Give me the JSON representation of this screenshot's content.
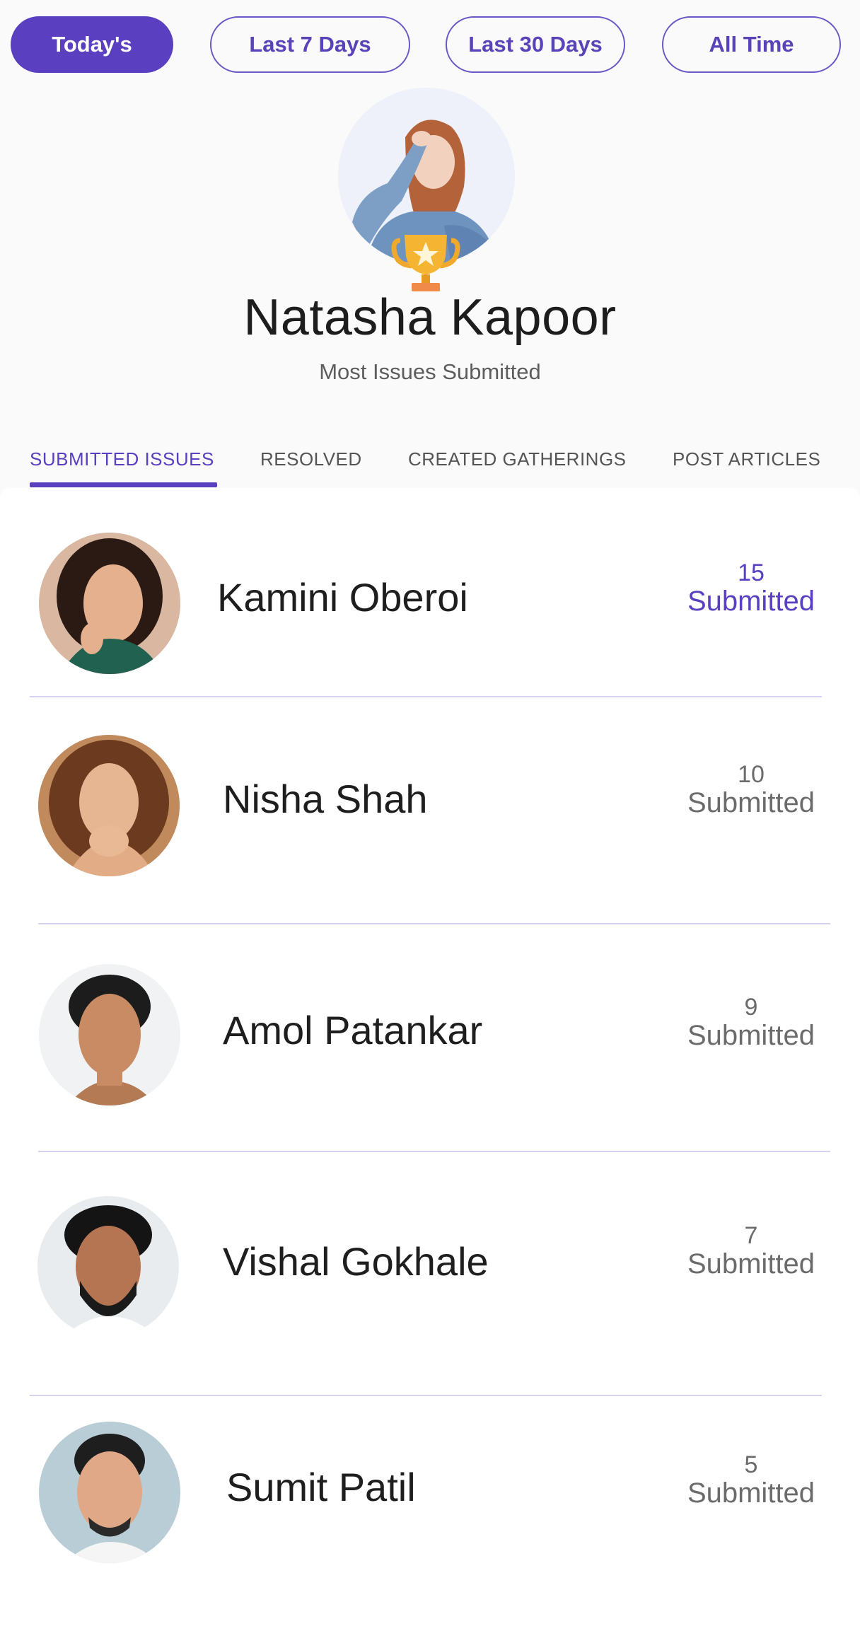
{
  "filters": [
    {
      "label": "Today's",
      "active": true
    },
    {
      "label": "Last 7 Days",
      "active": false
    },
    {
      "label": "Last 30 Days",
      "active": false
    },
    {
      "label": "All Time",
      "active": false
    }
  ],
  "hero": {
    "name": "Natasha Kapoor",
    "subtitle": "Most Issues Submitted",
    "badge_icon": "trophy-icon"
  },
  "tabs": [
    {
      "label": "SUBMITTED ISSUES",
      "active": true
    },
    {
      "label": "RESOLVED",
      "active": false
    },
    {
      "label": "CREATED GATHERINGS",
      "active": false
    },
    {
      "label": "POST ARTICLES",
      "active": false
    }
  ],
  "leaderboard": [
    {
      "name": "Kamini Oberoi",
      "count": "15",
      "unit": "Submitted",
      "highlight": true
    },
    {
      "name": "Nisha Shah",
      "count": "10",
      "unit": "Submitted",
      "highlight": false
    },
    {
      "name": "Amol Patankar",
      "count": "9",
      "unit": "Submitted",
      "highlight": false
    },
    {
      "name": "Vishal Gokhale",
      "count": "7",
      "unit": "Submitted",
      "highlight": false
    },
    {
      "name": "Sumit Patil",
      "count": "5",
      "unit": "Submitted",
      "highlight": false
    }
  ],
  "colors": {
    "accent": "#5a3fc0",
    "divider": "#d7d3ee",
    "trophy": "#f5b431"
  }
}
